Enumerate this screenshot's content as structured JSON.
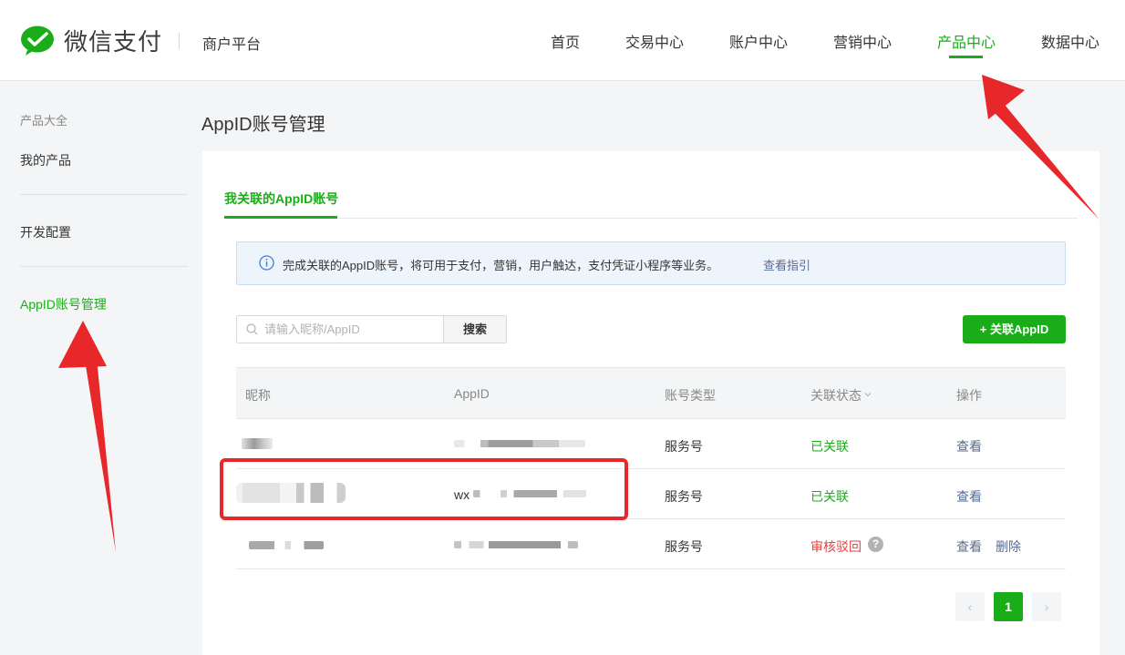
{
  "header": {
    "logo_text": "微信支付",
    "platform": "商户平台",
    "nav": [
      {
        "label": "首页"
      },
      {
        "label": "交易中心"
      },
      {
        "label": "账户中心"
      },
      {
        "label": "营销中心"
      },
      {
        "label": "产品中心",
        "active": true
      },
      {
        "label": "数据中心"
      }
    ]
  },
  "sidebar": {
    "group_label": "产品大全",
    "items": [
      {
        "label": "我的产品"
      },
      {
        "label": "开发配置"
      },
      {
        "label": "AppID账号管理",
        "active": true
      }
    ]
  },
  "main": {
    "page_title": "AppID账号管理",
    "tab_label": "我关联的AppID账号",
    "notice": {
      "text": "完成关联的AppID账号，将可用于支付，营销，用户触达，支付凭证小程序等业务。",
      "link": "查看指引"
    },
    "search": {
      "placeholder": "请输入昵称/AppID",
      "button": "搜索"
    },
    "add_button": "+ 关联AppID",
    "table": {
      "columns": [
        "昵称",
        "AppID",
        "账号类型",
        "关联状态",
        "操作"
      ],
      "rows": [
        {
          "account_type": "服务号",
          "status": "已关联",
          "status_type": "linked",
          "actions": [
            "查看"
          ]
        },
        {
          "appid_prefix": "wx",
          "account_type": "服务号",
          "status": "已关联",
          "status_type": "linked",
          "actions": [
            "查看"
          ]
        },
        {
          "account_type": "服务号",
          "status": "审核驳回",
          "status_type": "rejected",
          "actions": [
            "查看",
            "删除"
          ]
        }
      ]
    },
    "pagination": {
      "prev": "‹",
      "current": "1",
      "next": "›"
    }
  },
  "colors": {
    "brand_green": "#1aad19",
    "link_blue": "#576b95",
    "rejected_red": "#e64340",
    "annotation_red": "#e8272a"
  }
}
